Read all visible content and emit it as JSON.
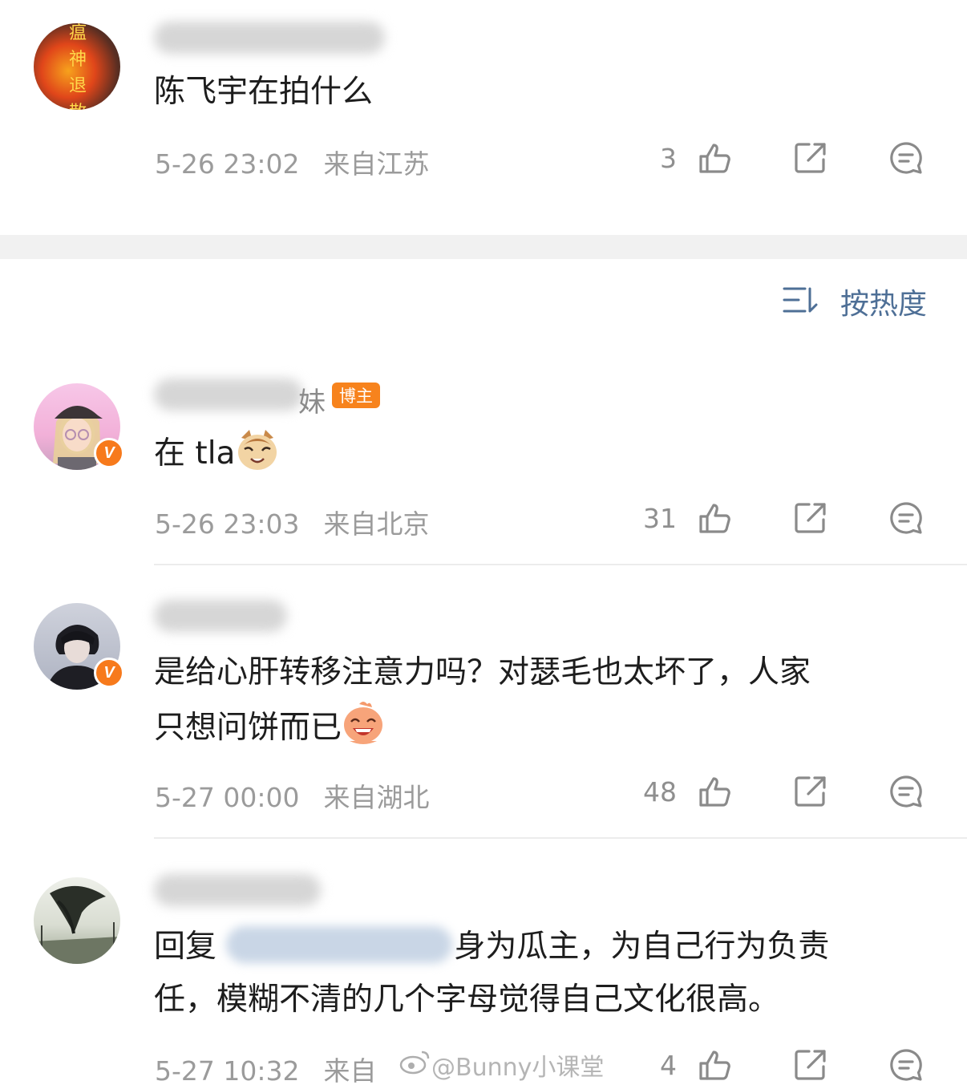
{
  "comments": [
    {
      "text": "陈飞宇在拍什么",
      "time": "5-26 23:02",
      "location": "来自江苏",
      "likes": "3",
      "avatar_text": [
        "瘟",
        "神",
        "退",
        "散"
      ]
    },
    {
      "name_tail": "妹",
      "badge": "博主",
      "text": "在 tla",
      "time": "5-26 23:03",
      "location": "来自北京",
      "likes": "31",
      "verified": "V"
    },
    {
      "text_line1": "是给心肝转移注意力吗？对瑟毛也太坏了，人家",
      "text_line2": "只想问饼而已",
      "time": "5-27 00:00",
      "location": "来自湖北",
      "likes": "48",
      "verified": "V"
    },
    {
      "reply_prefix": "回复",
      "text_line1_rest": "身为瓜主，为自己行为负责",
      "text_line2": "任，模糊不清的几个字母觉得自己文化很高。",
      "time": "5-27 10:32",
      "location": "来自",
      "likes": "4"
    }
  ],
  "sort": {
    "label": "按热度",
    "icon": "sort-icon"
  },
  "watermark": "@Bunny小课堂",
  "colors": {
    "accent": "#4e6f96",
    "badge": "#f7831d",
    "meta": "#9b9b9b"
  }
}
